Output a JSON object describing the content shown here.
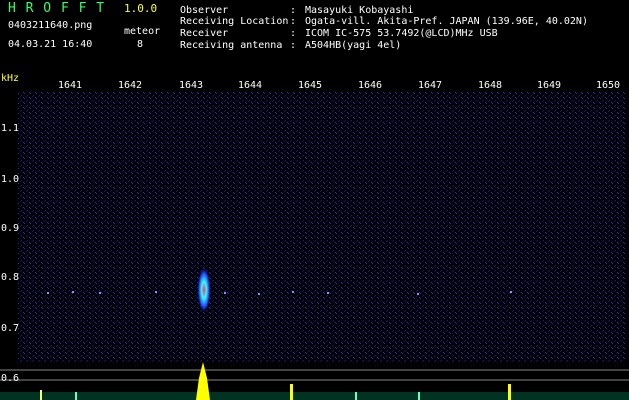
{
  "header": {
    "brand": "H R O F F T",
    "version": "1.0.0",
    "filename": "0403211640.png",
    "datetime": "04.03.21 16:40",
    "meteor_label": "meteor",
    "meteor_count": "8"
  },
  "info": [
    {
      "label": "Observer",
      "value": "Masayuki Kobayashi"
    },
    {
      "label": "Receiving Location",
      "value": "Ogata-vill. Akita-Pref. JAPAN (139.96E, 40.02N)"
    },
    {
      "label": "Receiver",
      "value": "ICOM IC-575 53.7492(@LCD)MHz USB"
    },
    {
      "label": "Receiving antenna",
      "value": "A504HB(yagi 4el)"
    }
  ],
  "spectrogram": {
    "unit": "kHz",
    "time_axis": [
      "1641",
      "1642",
      "1643",
      "1644",
      "1645",
      "1646",
      "1647",
      "1648",
      "1649",
      "1650"
    ],
    "freq_axis": [
      "1.1",
      "1.0",
      "0.9",
      "0.8",
      "0.7",
      "0.6"
    ],
    "colors": {
      "text_yellow": "#ffff33",
      "text_cyan": "#66ffff",
      "text_green": "#33ff66",
      "noise": "#1a1aa0",
      "signal": "#ffff00",
      "echo": "#ff3366"
    }
  }
}
